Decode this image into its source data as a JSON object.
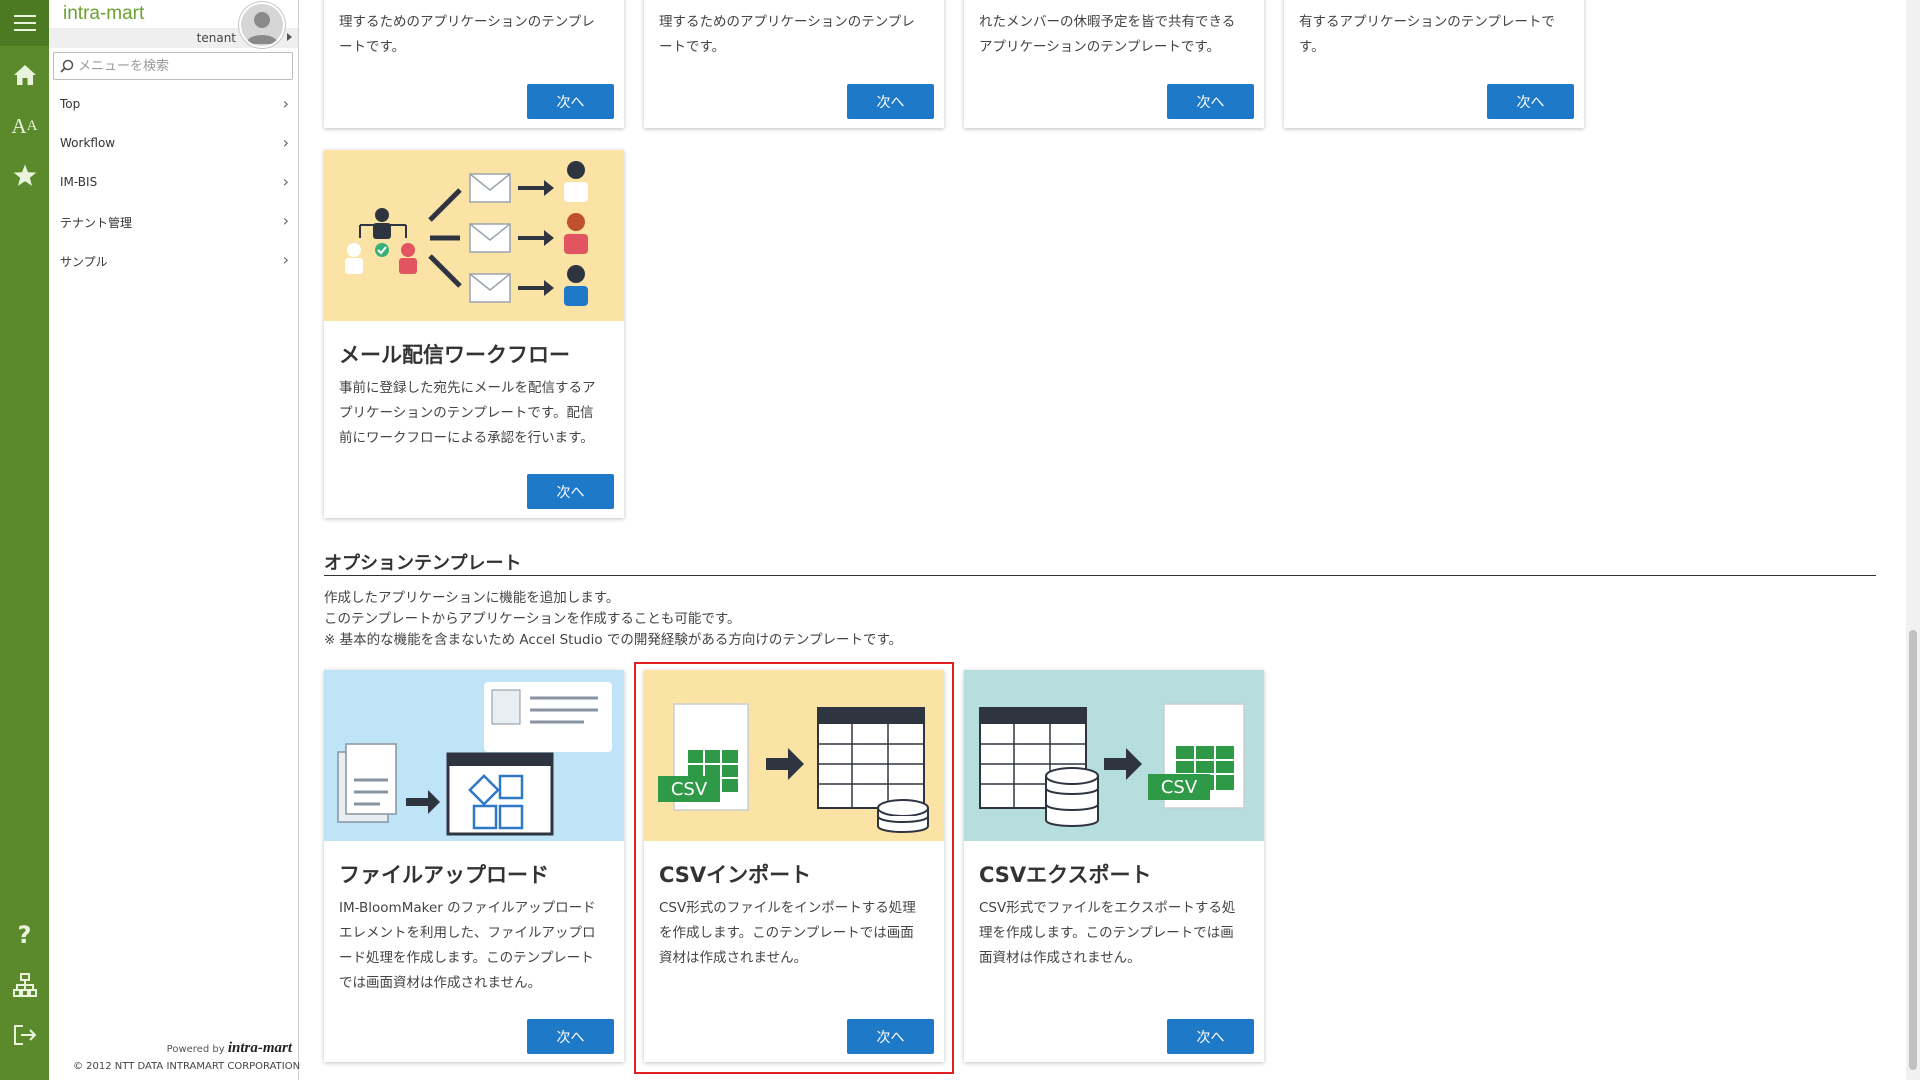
{
  "app": {
    "brand": "intra-mart",
    "tenant": "tenant"
  },
  "search": {
    "placeholder": "メニューを検索"
  },
  "nav": [
    {
      "label": "Top"
    },
    {
      "label": "Workflow"
    },
    {
      "label": "IM-BIS"
    },
    {
      "label": "テナント管理"
    },
    {
      "label": "サンプル"
    }
  ],
  "footer": {
    "powered": "Powered by",
    "logo": "intra-mart",
    "copyright": "© 2012 NTT DATA INTRAMART CORPORATION"
  },
  "top_cards": [
    {
      "text": [
        "理するためのアプリケーションのテンプレ",
        "ートです。"
      ],
      "button": "次へ"
    },
    {
      "text": [
        "理するためのアプリケーションのテンプレ",
        "ートです。"
      ],
      "button": "次へ"
    },
    {
      "text": [
        "れたメンバーの休暇予定を皆で共有できる",
        "アプリケーションのテンプレートです。"
      ],
      "button": "次へ"
    },
    {
      "text": [
        "有するアプリケーションのテンプレートで",
        "す。"
      ],
      "button": "次へ"
    }
  ],
  "mail_card": {
    "title": "メール配信ワークフロー",
    "text": [
      "事前に登録した宛先にメールを配信するア",
      "プリケーションのテンプレートです。配信",
      "前にワークフローによる承認を行います。"
    ],
    "button": "次へ"
  },
  "option_section": {
    "title": "オプションテンプレート",
    "desc": [
      "作成したアプリケーションに機能を追加します。",
      "このテンプレートからアプリケーションを作成することも可能です。",
      "※ 基本的な機能を含まないため Accel Studio での開発経験がある方向けのテンプレートです。"
    ]
  },
  "option_cards": [
    {
      "title": "ファイルアップロード",
      "text": [
        "IM-BloomMaker のファイルアップロード",
        "エレメントを利用した、ファイルアップロ",
        "ード処理を作成します。このテンプレート",
        "では画面資材は作成されません。"
      ],
      "button": "次へ"
    },
    {
      "title": "CSVインポート",
      "text": [
        "CSV形式のファイルをインポートする処理",
        "を作成します。このテンプレートでは画面",
        "資材は作成されません。"
      ],
      "button": "次へ",
      "badge": "CSV"
    },
    {
      "title": "CSVエクスポート",
      "text": [
        "CSV形式でファイルをエクスポートする処",
        "理を作成します。このテンプレートでは画",
        "面資材は作成されません。"
      ],
      "button": "次へ",
      "badge": "CSV"
    }
  ],
  "colors": {
    "rail": "#5a8a2c",
    "button": "#1f79c9",
    "highlight": "#e02020",
    "mail_bg": "#fbe3a6",
    "upload_bg": "#bfe3f7",
    "import_bg": "#fbe3a6",
    "export_bg": "#b6dedc"
  }
}
